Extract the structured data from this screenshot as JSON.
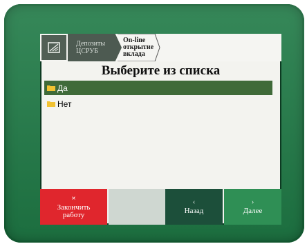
{
  "breadcrumb": {
    "icon": "card-reader-icon",
    "step1": [
      "Депозиты",
      "ЦСРУБ"
    ],
    "step2": [
      "On-line",
      "открытие",
      "вклада"
    ]
  },
  "title": "Выберите из списка",
  "options": [
    {
      "label": "Да",
      "selected": true
    },
    {
      "label": "Нет",
      "selected": false
    }
  ],
  "buttons": {
    "finish": {
      "icon": "×",
      "label": "Закончить работу"
    },
    "back": {
      "icon": "‹",
      "label": "Назад"
    },
    "next": {
      "icon": "›",
      "label": "Далее"
    }
  },
  "colors": {
    "bezel": "#1f7a46",
    "selected_row": "#3f6a39",
    "finish_button": "#e0262d",
    "back_button": "#1c4f3a",
    "next_button": "#2f8f55"
  }
}
